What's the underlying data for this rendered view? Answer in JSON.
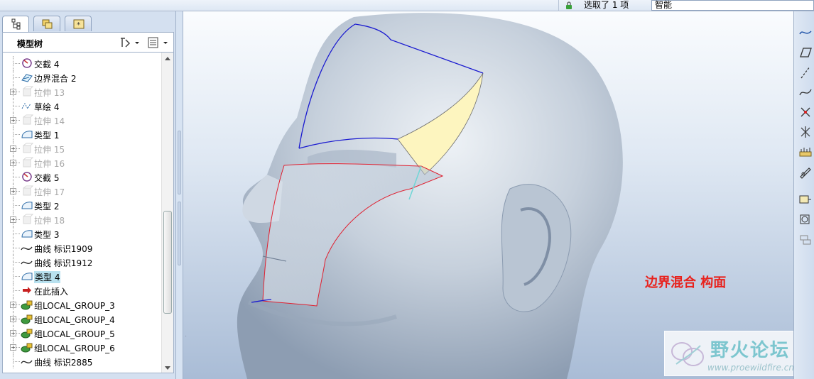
{
  "topbar": {
    "selection_text": "选取了 1 项",
    "filter_value": "智能"
  },
  "model_tree": {
    "title": "模型树",
    "items": [
      {
        "label": "交截 4",
        "icon": "intersect-icon",
        "dim": false,
        "expander": false
      },
      {
        "label": "边界混合 2",
        "icon": "boundary-blend-icon",
        "dim": false,
        "expander": false
      },
      {
        "label": "拉伸 13",
        "icon": "extrude-icon",
        "dim": true,
        "expander": true
      },
      {
        "label": "草绘 4",
        "icon": "sketch-icon",
        "dim": false,
        "expander": false
      },
      {
        "label": "拉伸 14",
        "icon": "extrude-icon",
        "dim": true,
        "expander": true
      },
      {
        "label": "类型 1",
        "icon": "surface-icon",
        "dim": false,
        "expander": false
      },
      {
        "label": "拉伸 15",
        "icon": "extrude-icon",
        "dim": true,
        "expander": true
      },
      {
        "label": "拉伸 16",
        "icon": "extrude-icon",
        "dim": true,
        "expander": true
      },
      {
        "label": "交截 5",
        "icon": "intersect-icon",
        "dim": false,
        "expander": false
      },
      {
        "label": "拉伸 17",
        "icon": "extrude-icon",
        "dim": true,
        "expander": true
      },
      {
        "label": "类型 2",
        "icon": "surface-icon",
        "dim": false,
        "expander": false
      },
      {
        "label": "拉伸 18",
        "icon": "extrude-icon",
        "dim": true,
        "expander": true
      },
      {
        "label": "类型 3",
        "icon": "surface-icon",
        "dim": false,
        "expander": false
      },
      {
        "label": "曲线 标识1909",
        "icon": "curve-icon",
        "dim": false,
        "expander": false
      },
      {
        "label": "曲线 标识1912",
        "icon": "curve-icon",
        "dim": false,
        "expander": false
      },
      {
        "label": "类型 4",
        "icon": "surface-icon",
        "dim": false,
        "expander": false,
        "selected": true
      },
      {
        "label": "在此插入",
        "icon": "insert-arrow-icon",
        "dim": false,
        "expander": false
      },
      {
        "label": "组LOCAL_GROUP_3",
        "icon": "group-icon",
        "dim": false,
        "expander": true
      },
      {
        "label": "组LOCAL_GROUP_4",
        "icon": "group-icon",
        "dim": false,
        "expander": true
      },
      {
        "label": "组LOCAL_GROUP_5",
        "icon": "group-icon",
        "dim": false,
        "expander": true
      },
      {
        "label": "组LOCAL_GROUP_6",
        "icon": "group-icon",
        "dim": false,
        "expander": true
      },
      {
        "label": "曲线 标识2885",
        "icon": "curve-icon",
        "dim": false,
        "expander": false
      }
    ]
  },
  "viewport": {
    "annotation": "边界混合 构面",
    "watermark_title": "野火论坛",
    "watermark_url": "www.proewildfire.cn"
  },
  "colors": {
    "annotation": "#e8221d",
    "selected_row": "#b8e1ef",
    "blue_curve": "#1a1ad0",
    "red_curve": "#e02030",
    "fill_surface": "#fdf5bf"
  }
}
